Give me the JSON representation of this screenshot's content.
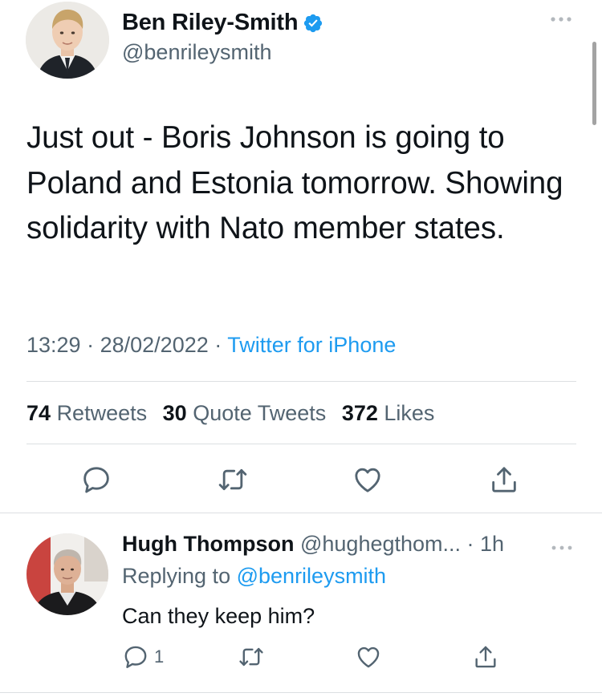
{
  "tweet": {
    "author_name": "Ben Riley-Smith",
    "author_handle": "@benrileysmith",
    "verified": true,
    "text": "Just out - Boris Johnson is going to Poland and Estonia tomorrow. Showing solidarity with Nato member states.",
    "time": "13:29",
    "date": "28/02/2022",
    "separator": "·",
    "source": "Twitter for iPhone",
    "stats": {
      "retweets_count": "74",
      "retweets_label": "Retweets",
      "quotes_count": "30",
      "quotes_label": "Quote Tweets",
      "likes_count": "372",
      "likes_label": "Likes"
    },
    "actions": [
      "reply-icon",
      "retweet-icon",
      "like-icon",
      "share-icon"
    ]
  },
  "reply": {
    "author_name": "Hugh Thompson",
    "author_handle": "@hughegthom...",
    "time_ago": "· 1h",
    "replying_prefix": "Replying to",
    "replying_to": "@benrileysmith",
    "text": "Can they keep him?",
    "reply_count": "1",
    "actions": [
      "reply-icon",
      "retweet-icon",
      "like-icon",
      "share-icon"
    ]
  },
  "colors": {
    "accent": "#1d9bf0",
    "text": "#0f1419",
    "secondary": "#536471",
    "divider": "#dcdfe2"
  }
}
